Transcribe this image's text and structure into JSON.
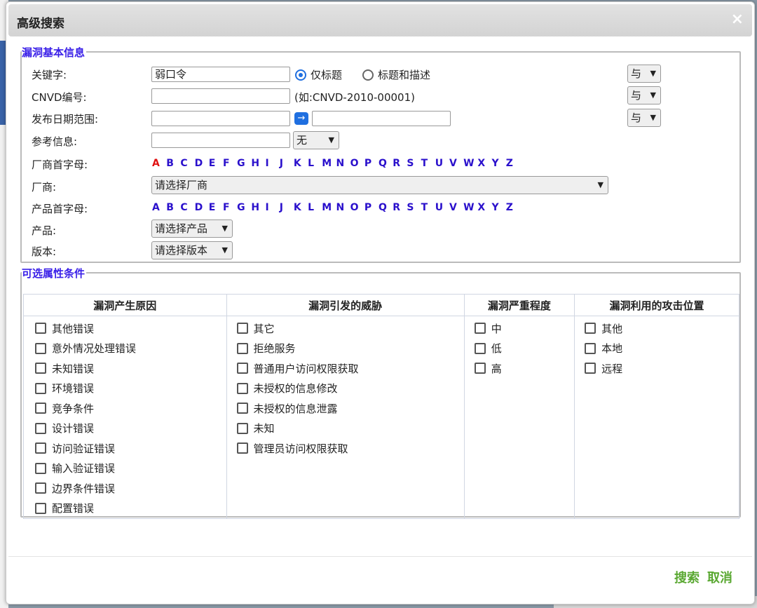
{
  "dialog": {
    "title": "高级搜索",
    "close_symbol": "×"
  },
  "basic": {
    "legend": "漏洞基本信息",
    "keyword": {
      "label": "关键字:",
      "value": "弱口令"
    },
    "title_only": "仅标题",
    "title_desc": "标题和描述",
    "cnvd": {
      "label": "CNVD编号:",
      "value": "",
      "hint": "(如:CNVD-2010-00001)"
    },
    "date": {
      "label": "发布日期范围:",
      "from": "",
      "to": "",
      "arrow": "→"
    },
    "ref": {
      "label": "参考信息:",
      "value": "",
      "select": "无"
    },
    "vendor_letter_label": "厂商首字母:",
    "vendor_label": "厂商:",
    "vendor_select": "请选择厂商",
    "product_letter_label": "产品首字母:",
    "product_label": "产品:",
    "product_select": "请选择产品",
    "version_label": "版本:",
    "version_select": "请选择版本",
    "logic_op": "与",
    "letters": [
      "A",
      "B",
      "C",
      "D",
      "E",
      "F",
      "G",
      "H",
      "I",
      "J",
      "K",
      "L",
      "M",
      "N",
      "O",
      "P",
      "Q",
      "R",
      "S",
      "T",
      "U",
      "V",
      "W",
      "X",
      "Y",
      "Z"
    ],
    "vendor_selected_letter": "A"
  },
  "optional": {
    "legend": "可选属性条件",
    "columns": [
      {
        "header": "漏洞产生原因",
        "items": [
          "其他错误",
          "意外情况处理错误",
          "未知错误",
          "环境错误",
          "竞争条件",
          "设计错误",
          "访问验证错误",
          "输入验证错误",
          "边界条件错误",
          "配置错误"
        ]
      },
      {
        "header": "漏洞引发的威胁",
        "items": [
          "其它",
          "拒绝服务",
          "普通用户访问权限获取",
          "未授权的信息修改",
          "未授权的信息泄露",
          "未知",
          "管理员访问权限获取"
        ]
      },
      {
        "header": "漏洞严重程度",
        "items": [
          "中",
          "低",
          "高"
        ]
      },
      {
        "header": "漏洞利用的攻击位置",
        "items": [
          "其他",
          "本地",
          "远程"
        ]
      }
    ]
  },
  "footer": {
    "search": "搜索",
    "cancel": "取消"
  },
  "icons": {
    "chevron": "chevron-down-icon",
    "arrow": "arrow-right-icon",
    "close": "close-icon"
  }
}
